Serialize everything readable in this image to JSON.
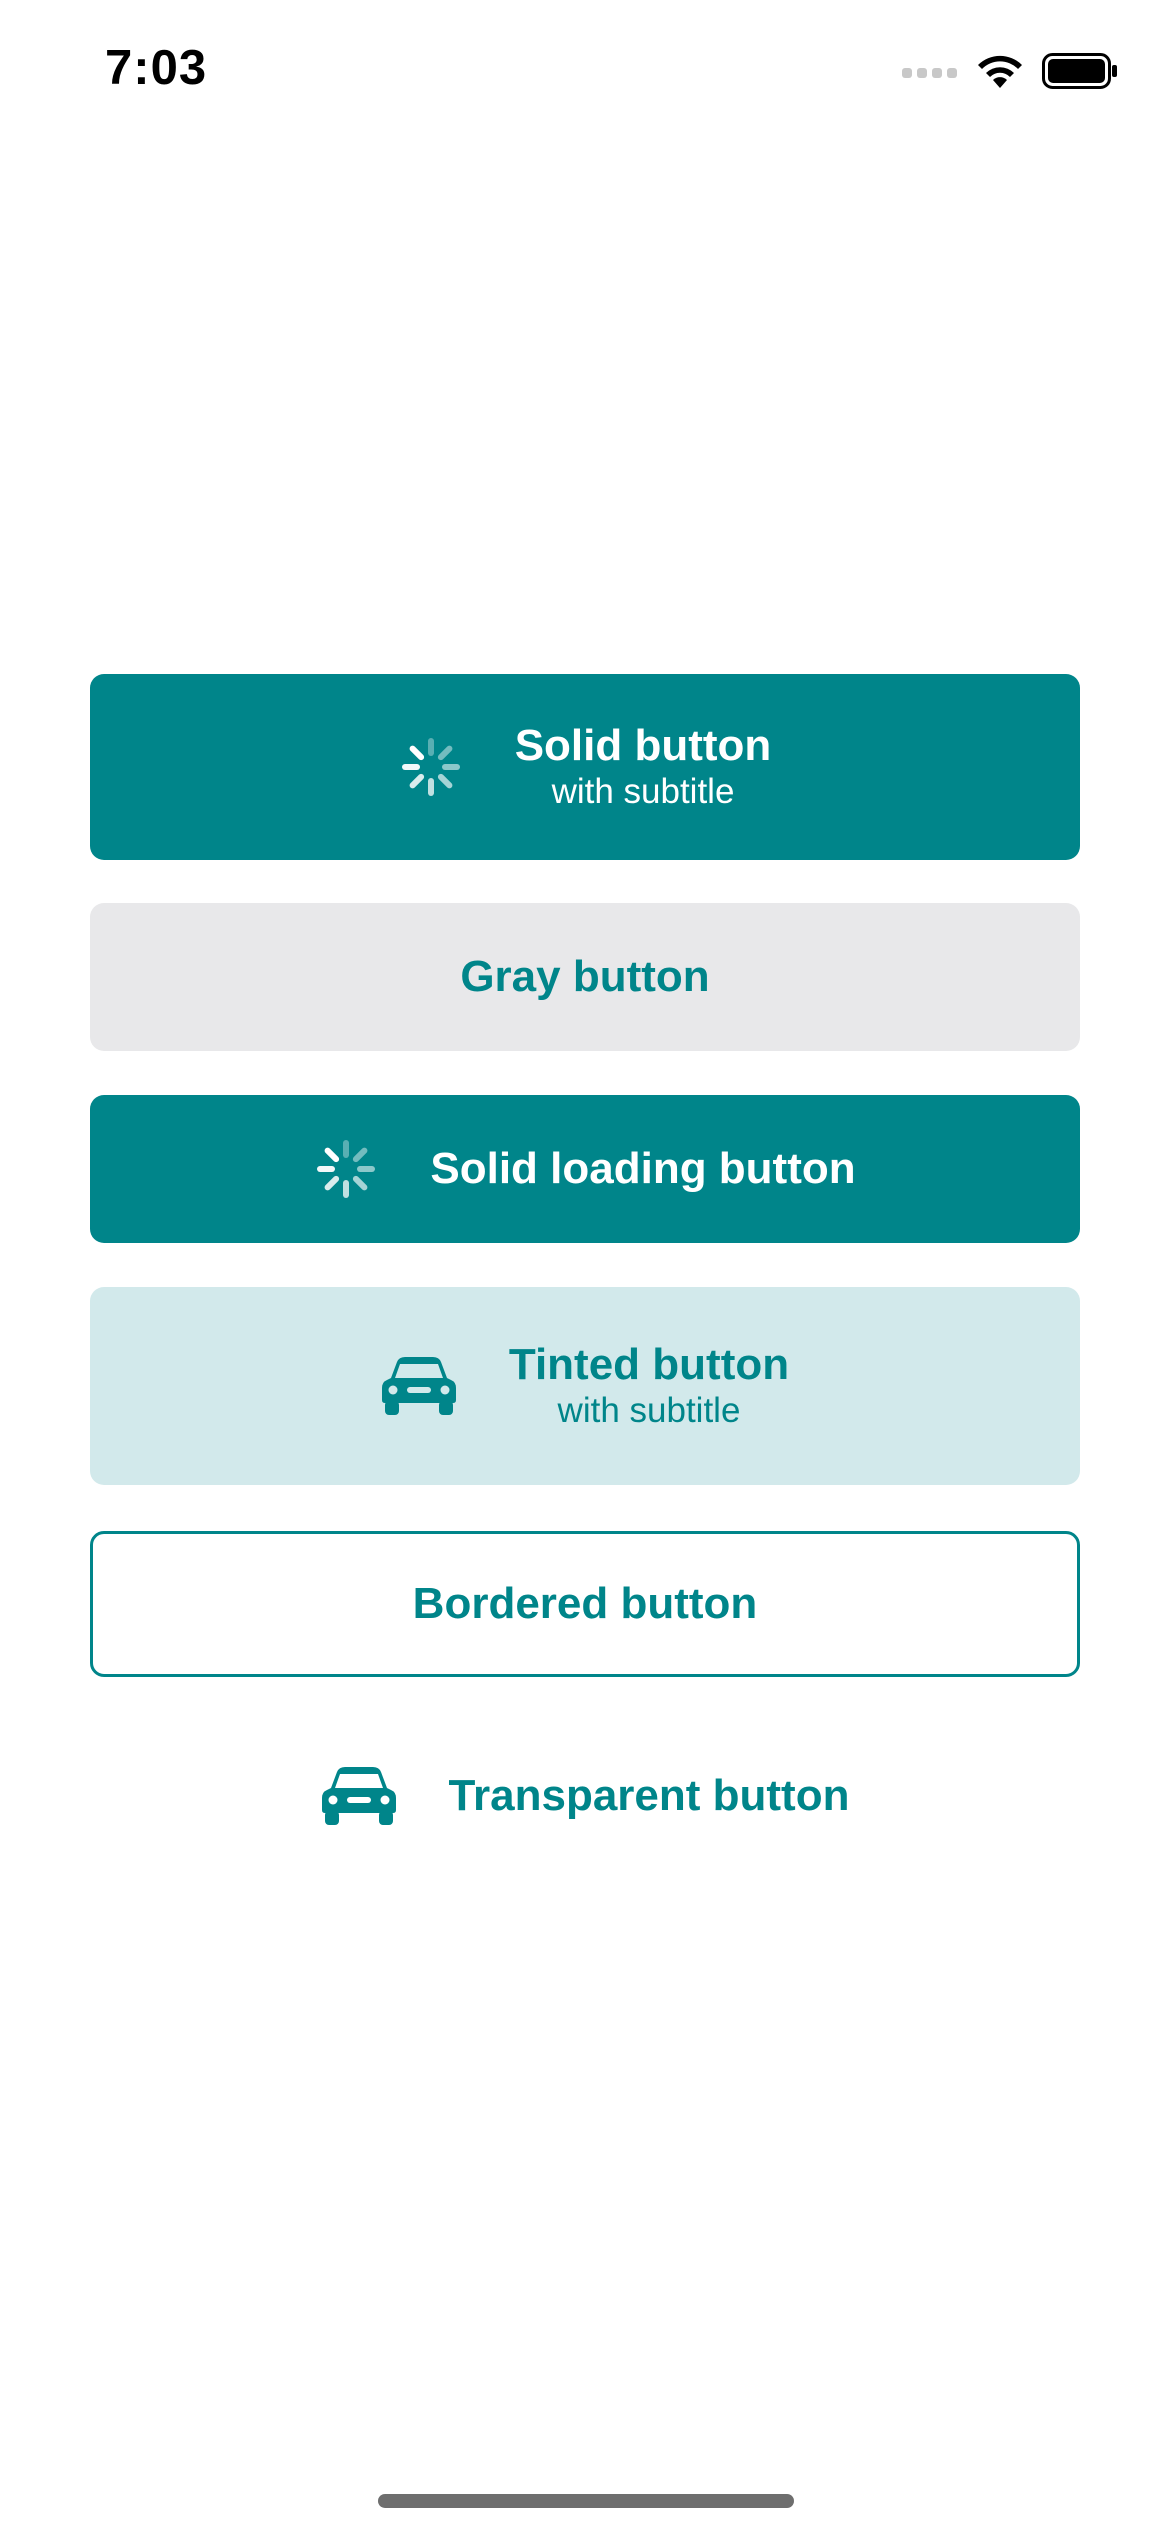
{
  "status_bar": {
    "time": "7:03"
  },
  "buttons": {
    "solid": {
      "title": "Solid button",
      "subtitle": "with subtitle",
      "icon": "spinner-icon"
    },
    "gray": {
      "title": "Gray button"
    },
    "solid_loading": {
      "title": "Solid loading button",
      "icon": "spinner-icon"
    },
    "tinted": {
      "title": "Tinted button",
      "subtitle": "with subtitle",
      "icon": "car-icon"
    },
    "bordered": {
      "title": "Bordered button"
    },
    "transparent": {
      "title": "Transparent button",
      "icon": "car-icon"
    }
  },
  "colors": {
    "accent": "#00858a",
    "gray_bg": "#e8e8ea",
    "tinted_bg": "#d2e9eb"
  }
}
